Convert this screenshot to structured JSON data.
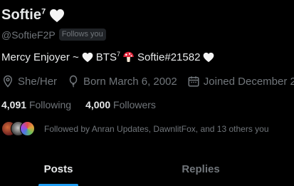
{
  "profile": {
    "display_name": "Softie",
    "display_name_sup": "7",
    "handle": "@SoftieF2P",
    "follows_you_badge": "Follows you"
  },
  "bio": {
    "part1": "Mercy Enjoyer ~",
    "part2": "BTS",
    "part2_sup": "7",
    "part3": "Softie#21582"
  },
  "meta": {
    "pronouns": "She/Her",
    "born": "Born March 6, 2002",
    "joined": "Joined December 2"
  },
  "stats": {
    "following_count": "4,091",
    "following_label": "Following",
    "followers_count": "4,000",
    "followers_label": "Followers"
  },
  "followed_by": {
    "text": "Followed by Anran Updates, DawnlitFox, and 13 others you"
  },
  "tabs": [
    {
      "label": "Posts",
      "active": true
    },
    {
      "label": "Replies",
      "active": false
    }
  ],
  "colors": {
    "background": "#000000",
    "primary_text": "#e7e9ea",
    "secondary_text": "#71767b",
    "accent": "#1d9bf0",
    "badge_bg": "#202327"
  }
}
